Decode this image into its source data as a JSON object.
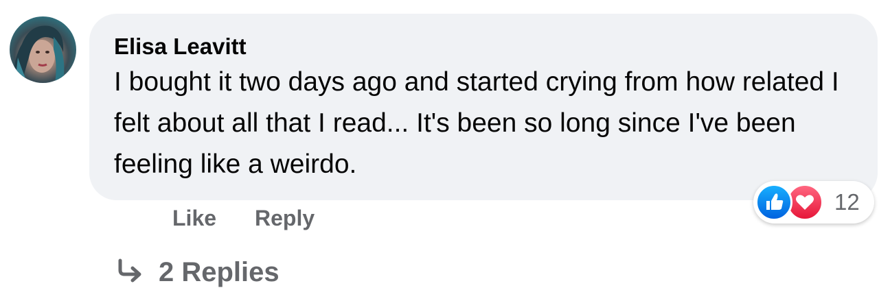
{
  "comment": {
    "author": "Elisa Leavitt",
    "text": "I bought it two days ago and started crying from how related I felt about all that I read... It's been so long since I've been feeling like a weirdo.",
    "reactions": {
      "icons": [
        "like-icon",
        "love-icon"
      ],
      "count": "12",
      "colors": {
        "like": "#1877f2",
        "love": "#f33e58"
      }
    },
    "actions": {
      "like_label": "Like",
      "reply_label": "Reply"
    },
    "replies": {
      "icon": "reply-arrow-icon",
      "label": "2 Replies"
    }
  },
  "colors": {
    "bubble_bg": "#f0f2f5",
    "text_primary": "#050505",
    "text_secondary": "#65676b"
  }
}
